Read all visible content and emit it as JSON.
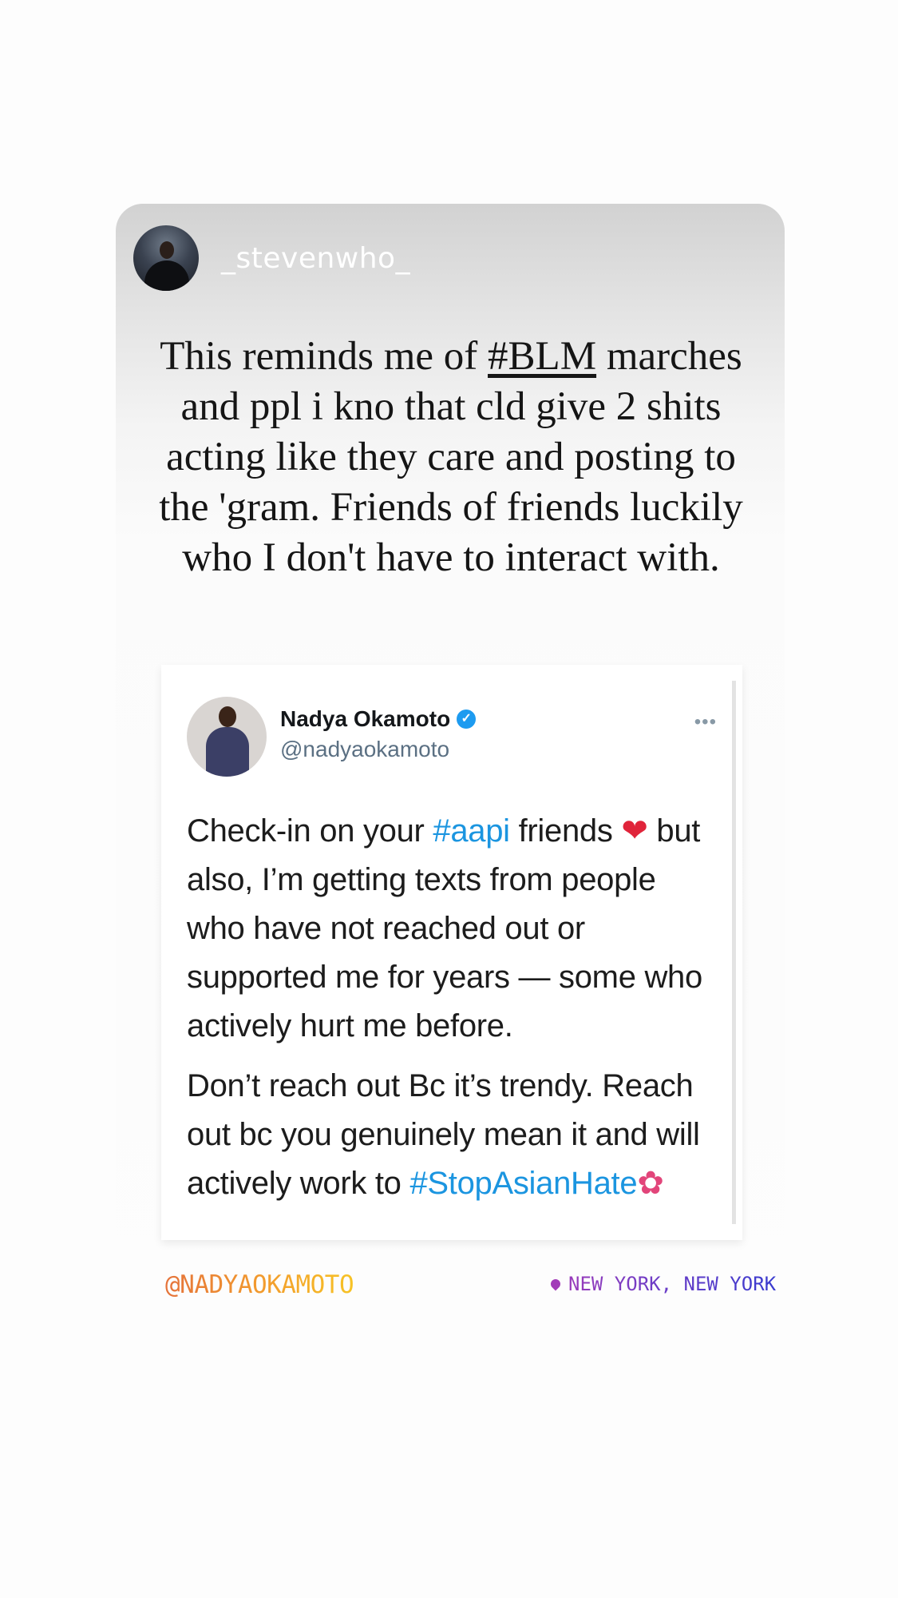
{
  "story": {
    "username": "_stevenwho_",
    "comment_before_tag": "This reminds me of ",
    "comment_tag": "#BLM",
    "comment_after_tag": " marches and ppl i kno that cld give 2 shits acting like they care and posting to the 'gram. Friends of friends luckily who I don't have to interact with."
  },
  "tweet": {
    "name": "Nadya Okamoto",
    "handle": "@nadyaokamoto",
    "p1_a": "Check-in on your ",
    "p1_tag": "#aapi",
    "p1_b": " friends ",
    "p1_emoji": "❤",
    "p1_c": " but also, I’m getting texts from people who have not reached out or supported me for years — some who actively hurt me before.",
    "p2_a": "Don’t reach out Bc it’s trendy. Reach out bc you genuinely mean it and will actively work to ",
    "p2_tag": "#StopAsianHate",
    "p2_emoji": "✿"
  },
  "footer": {
    "mention": "@NADYAOKAMOTO",
    "location": "NEW YORK, NEW YORK"
  },
  "colors": {
    "hashtag": "#1b95e0",
    "verified": "#1d9bf0"
  }
}
